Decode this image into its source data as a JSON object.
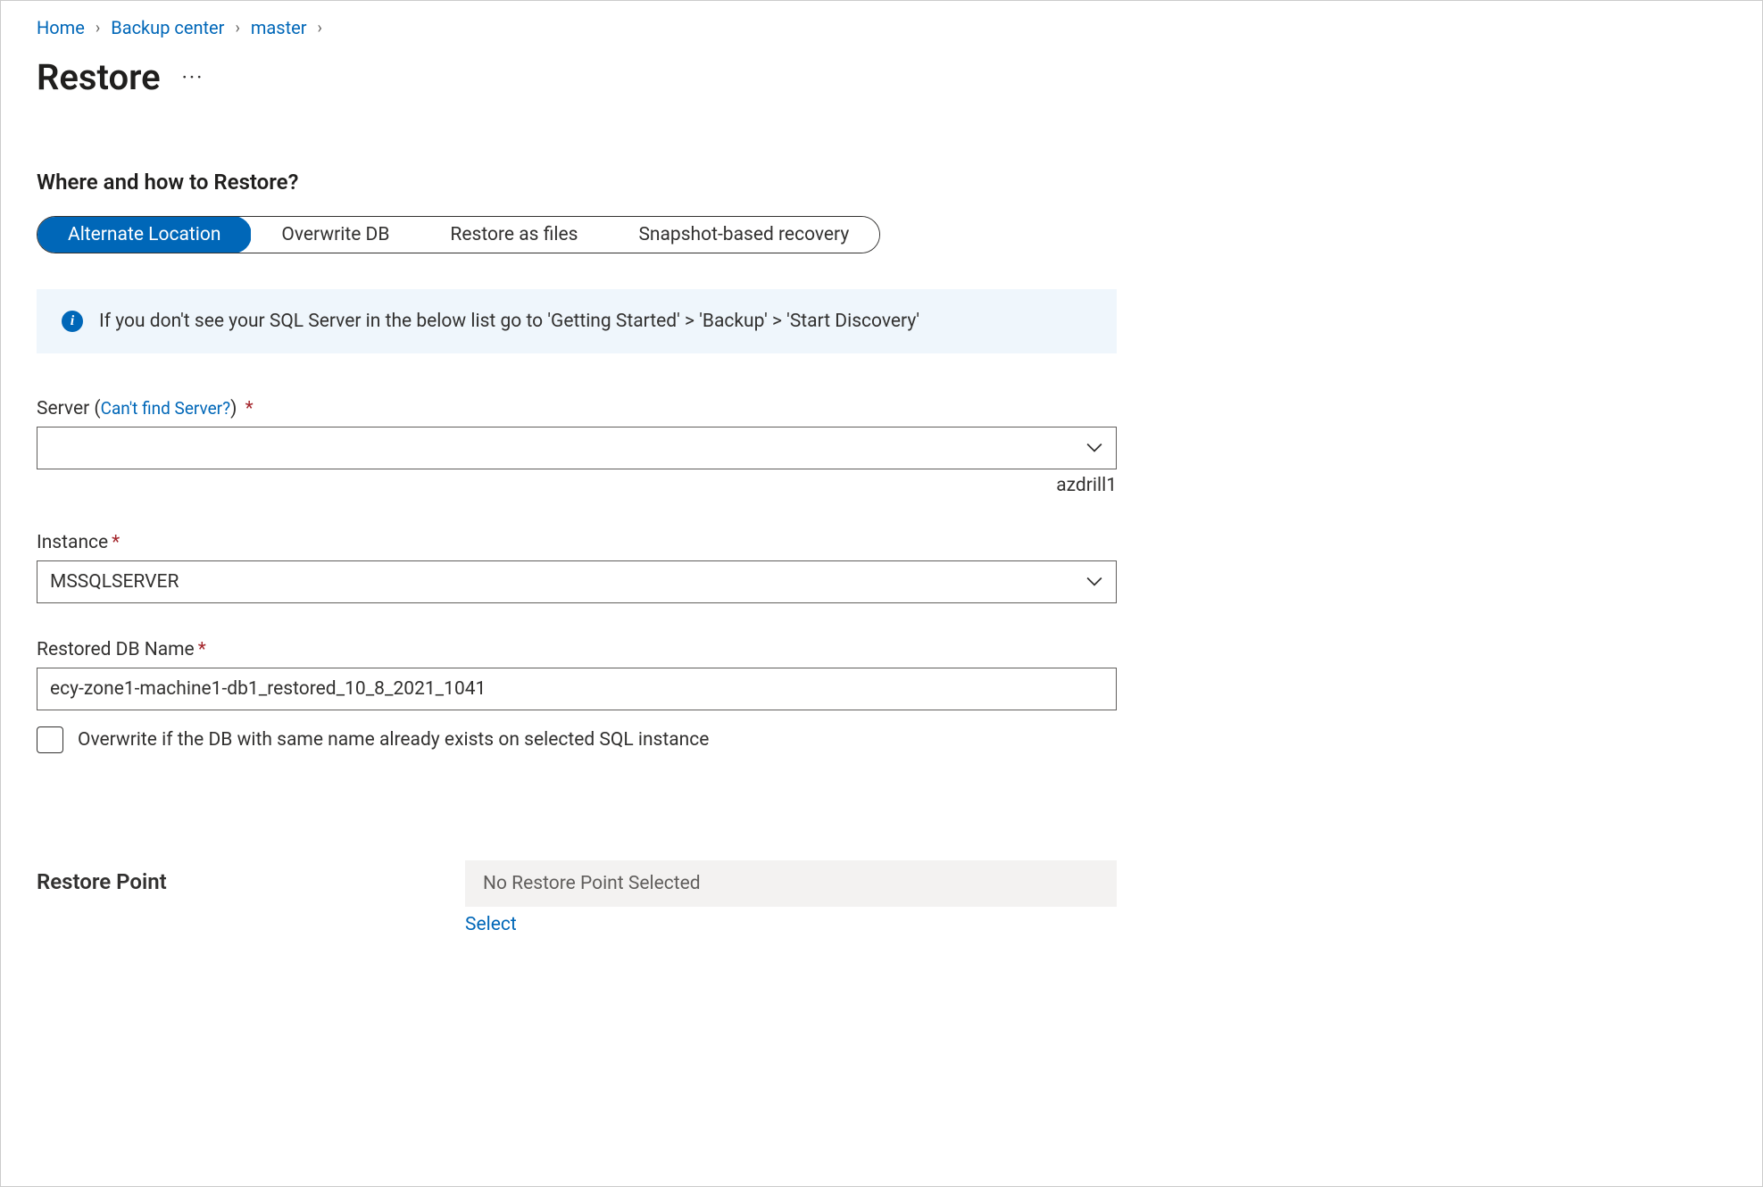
{
  "breadcrumb": {
    "home": "Home",
    "backup_center": "Backup center",
    "master": "master"
  },
  "page_title": "Restore",
  "section1_heading": "Where and how to Restore?",
  "tabs": {
    "alternate": "Alternate Location",
    "overwrite": "Overwrite DB",
    "files": "Restore as files",
    "snapshot": "Snapshot-based recovery"
  },
  "info_text": "If you don't see your SQL Server in the below list go to 'Getting Started' > 'Backup' > 'Start Discovery'",
  "server": {
    "label": "Server",
    "link": "Can't find Server?",
    "value": "",
    "helper": "azdrill1"
  },
  "instance": {
    "label": "Instance",
    "value": "MSSQLSERVER"
  },
  "restored_db": {
    "label": "Restored DB Name",
    "value": "ecy-zone1-machine1-db1_restored_10_8_2021_1041"
  },
  "overwrite_checkbox": "Overwrite if the DB with same name already exists on selected SQL instance",
  "restore_point": {
    "label": "Restore Point",
    "placeholder": "No Restore Point Selected",
    "select": "Select"
  }
}
